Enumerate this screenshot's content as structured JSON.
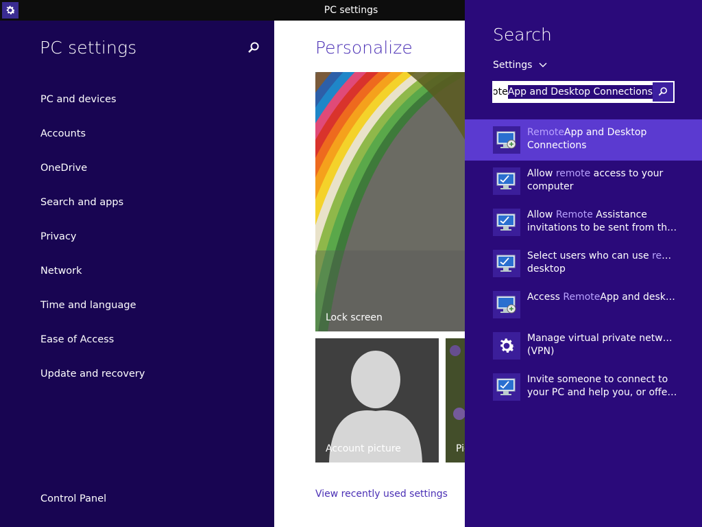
{
  "window": {
    "title": "PC settings"
  },
  "leftnav": {
    "heading": "PC settings",
    "items": [
      {
        "label": "PC and devices"
      },
      {
        "label": "Accounts"
      },
      {
        "label": "OneDrive"
      },
      {
        "label": "Search and apps"
      },
      {
        "label": "Privacy"
      },
      {
        "label": "Network"
      },
      {
        "label": "Time and language"
      },
      {
        "label": "Ease of Access"
      },
      {
        "label": "Update and recovery"
      }
    ],
    "control_panel": "Control Panel"
  },
  "main": {
    "page_title": "Personalize",
    "tiles": {
      "lock": "Lock screen",
      "account": "Account picture",
      "picture": "Pic"
    },
    "recent_link": "View recently used settings"
  },
  "search_charm": {
    "title": "Search",
    "scope": "Settings",
    "query_prefix": "ote",
    "query_selected": "App and Desktop Connections",
    "results": [
      {
        "l1_hl": "Remote",
        "l1": "App and Desktop",
        "l2": "Connections",
        "icon": "remote-desktop-icon",
        "active": true
      },
      {
        "l1_pre": "Allow ",
        "l1_hl": "remote",
        "l1": " access to your",
        "l2": "computer",
        "icon": "system-monitor-icon"
      },
      {
        "l1_pre": "Allow ",
        "l1_hl": "Remote",
        "l1": " Assistance",
        "l2": "invitations to be sent from this c...",
        "icon": "system-monitor-icon"
      },
      {
        "l1_pre": "Select users who can use ",
        "l1_hl": "remote",
        "l1": "",
        "l2": "desktop",
        "icon": "system-monitor-icon"
      },
      {
        "l1_pre": "Access ",
        "l1_hl": "Remote",
        "l1": "App and desktops",
        "l2": "",
        "icon": "remote-desktop-icon"
      },
      {
        "l1_pre": "Manage virtual private networks",
        "l1_hl": "",
        "l1": "",
        "l2": "(VPN)",
        "icon": "gear-icon"
      },
      {
        "l1_pre": "Invite someone to connect to",
        "l1_hl": "",
        "l1": "",
        "l2": "your PC and help you, or offer t...",
        "icon": "system-monitor-icon"
      }
    ]
  },
  "colors": {
    "nav_bg": "#180552",
    "charm_bg": "#2a0a7a",
    "active_result": "#5b3ad0",
    "accent": "#4a2fb5",
    "highlight": "#b9a3ff"
  }
}
